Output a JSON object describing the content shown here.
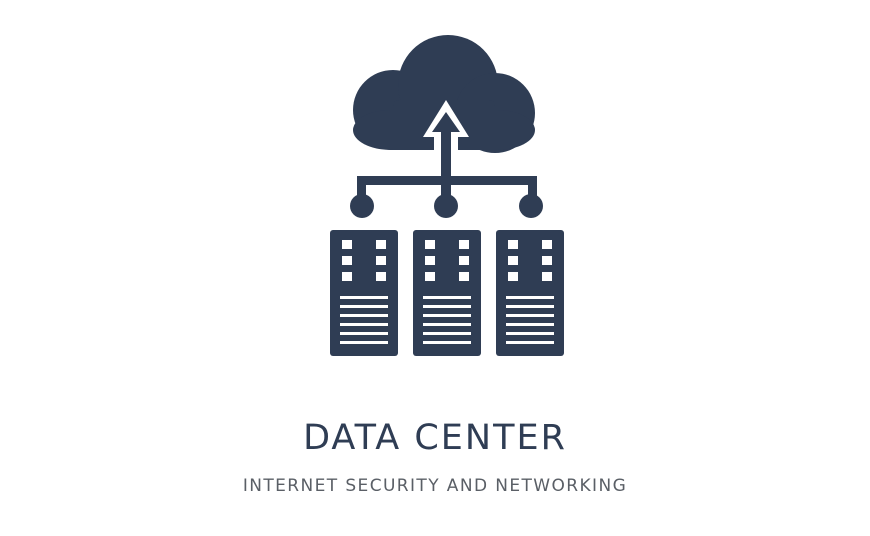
{
  "title": "DATA CENTER",
  "subtitle": "INTERNET SECURITY AND NETWORKING",
  "icon": {
    "name": "cloud-data-center-icon",
    "color": "#2f3d54",
    "background": "#ffffff"
  }
}
